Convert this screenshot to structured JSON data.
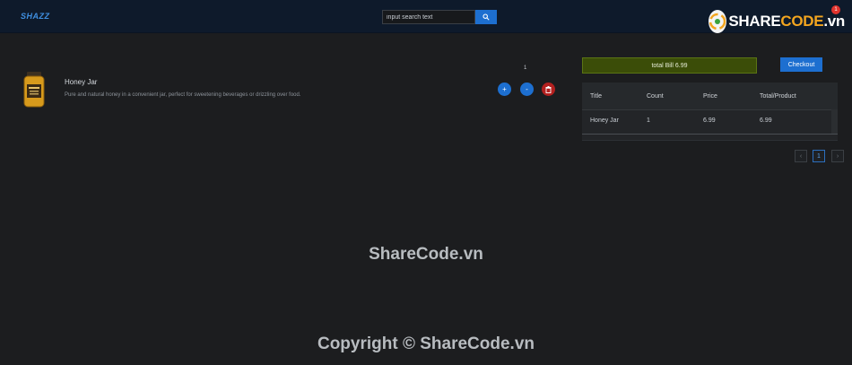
{
  "header": {
    "brand": "SHAZZ",
    "search": {
      "placeholder": "input search text",
      "value": "input search text"
    },
    "search_icon": "search-icon",
    "cart_count": "1"
  },
  "logo": {
    "text_main": "SHARE",
    "text_accent": "CODE",
    "text_suffix": ".vn"
  },
  "product": {
    "title": "Honey Jar",
    "description": "Pure and natural honey in a convenient jar, perfect for sweetening beverages or drizzling over food.",
    "quantity": "1",
    "actions": {
      "plus": "+",
      "minus": "-",
      "delete_icon": "trash-icon"
    }
  },
  "cart": {
    "total_label": "total Bill 6.99",
    "checkout_label": "Checkout",
    "columns": [
      "Title",
      "Count",
      "Price",
      "Total/Product"
    ],
    "rows": [
      {
        "title": "Honey Jar",
        "count": "1",
        "price": "6.99",
        "total": "6.99"
      }
    ],
    "pagination": {
      "prev": "‹",
      "current": "1",
      "next": "›"
    }
  },
  "watermarks": {
    "center": "ShareCode.vn",
    "footer": "Copyright © ShareCode.vn"
  },
  "colors": {
    "background": "#1c1d1f",
    "header": "#0e1a2b",
    "primary": "#1d6fd0",
    "danger": "#b3201f",
    "bill": "#3b4d08"
  }
}
